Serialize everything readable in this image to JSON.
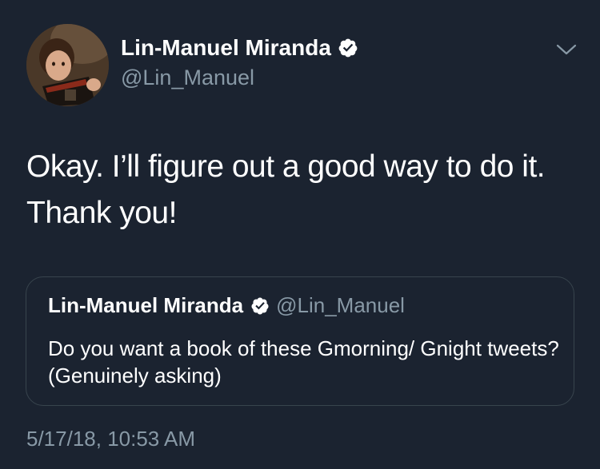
{
  "tweet": {
    "author": {
      "display_name": "Lin-Manuel Miranda",
      "handle": "@Lin_Manuel",
      "verified": true
    },
    "text": "Okay. I’ll figure out a good way to do it. Thank you!",
    "timestamp": "5/17/18, 10:53 AM"
  },
  "quoted_tweet": {
    "display_name": "Lin-Manuel Miranda",
    "handle": "@Lin_Manuel",
    "verified": true,
    "text": "Do you want a book of these Gmorning/ Gnight tweets? (Genuinely asking)"
  },
  "colors": {
    "background": "#1b2330",
    "primary_text": "#ffffff",
    "secondary_text": "#8899a6",
    "border": "#38444d"
  },
  "icons": {
    "verified": "verified-badge-icon",
    "menu": "chevron-down-icon"
  }
}
